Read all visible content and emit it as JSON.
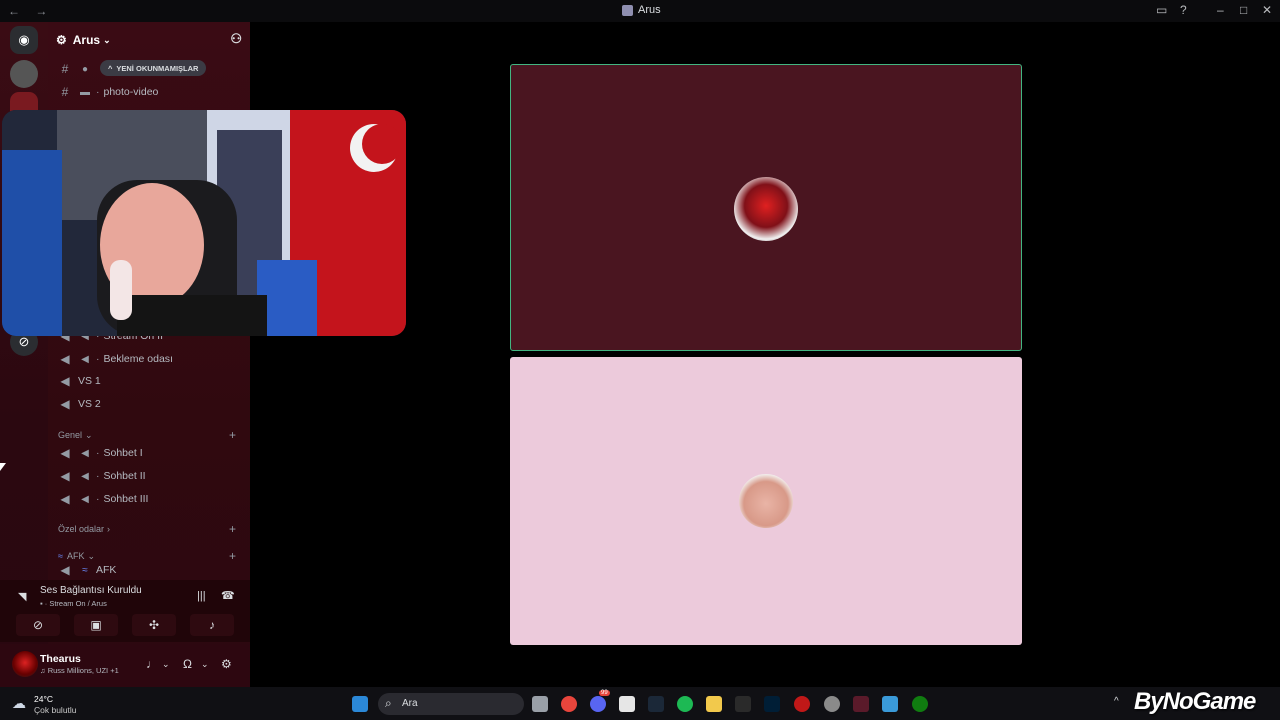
{
  "titlebar": {
    "title": "Arus",
    "nav_arrows": "← →"
  },
  "server": {
    "name": "Arus",
    "unread_pill": "YENİ OKUNMAMIŞLAR"
  },
  "channels": {
    "text": [
      {
        "name": ""
      },
      {
        "name": "photo-video"
      }
    ],
    "voice_top": [
      {
        "name": "Stream On II"
      },
      {
        "name": "Bekleme odası"
      }
    ],
    "voice_plain": [
      {
        "name": "VS 1"
      },
      {
        "name": "VS 2"
      }
    ],
    "categories": {
      "genel": "Genel",
      "ozel": "Özel odalar",
      "afk": "AFK"
    },
    "genel_channels": [
      {
        "name": "Sohbet I"
      },
      {
        "name": "Sohbet II"
      },
      {
        "name": "Sohbet III"
      }
    ],
    "afk_channel": "AFK"
  },
  "voice_status": {
    "title": "Ses Bağlantısı Kuruldu",
    "subtitle": "Stream On / Arus"
  },
  "user": {
    "name": "Thearus",
    "status": "Russ Millions, UZI +1"
  },
  "taskbar": {
    "weather_temp": "24°C",
    "weather_desc": "Çok bulutlu",
    "search_label": "Ara",
    "discord_badge": "99"
  },
  "watermark": "ByNoGame",
  "colors": {
    "speaking_border": "#43b581",
    "tile1_bg": "#4a1520",
    "tile2_bg": "#eccadb",
    "sidebar_bg": "#3a0b14"
  }
}
